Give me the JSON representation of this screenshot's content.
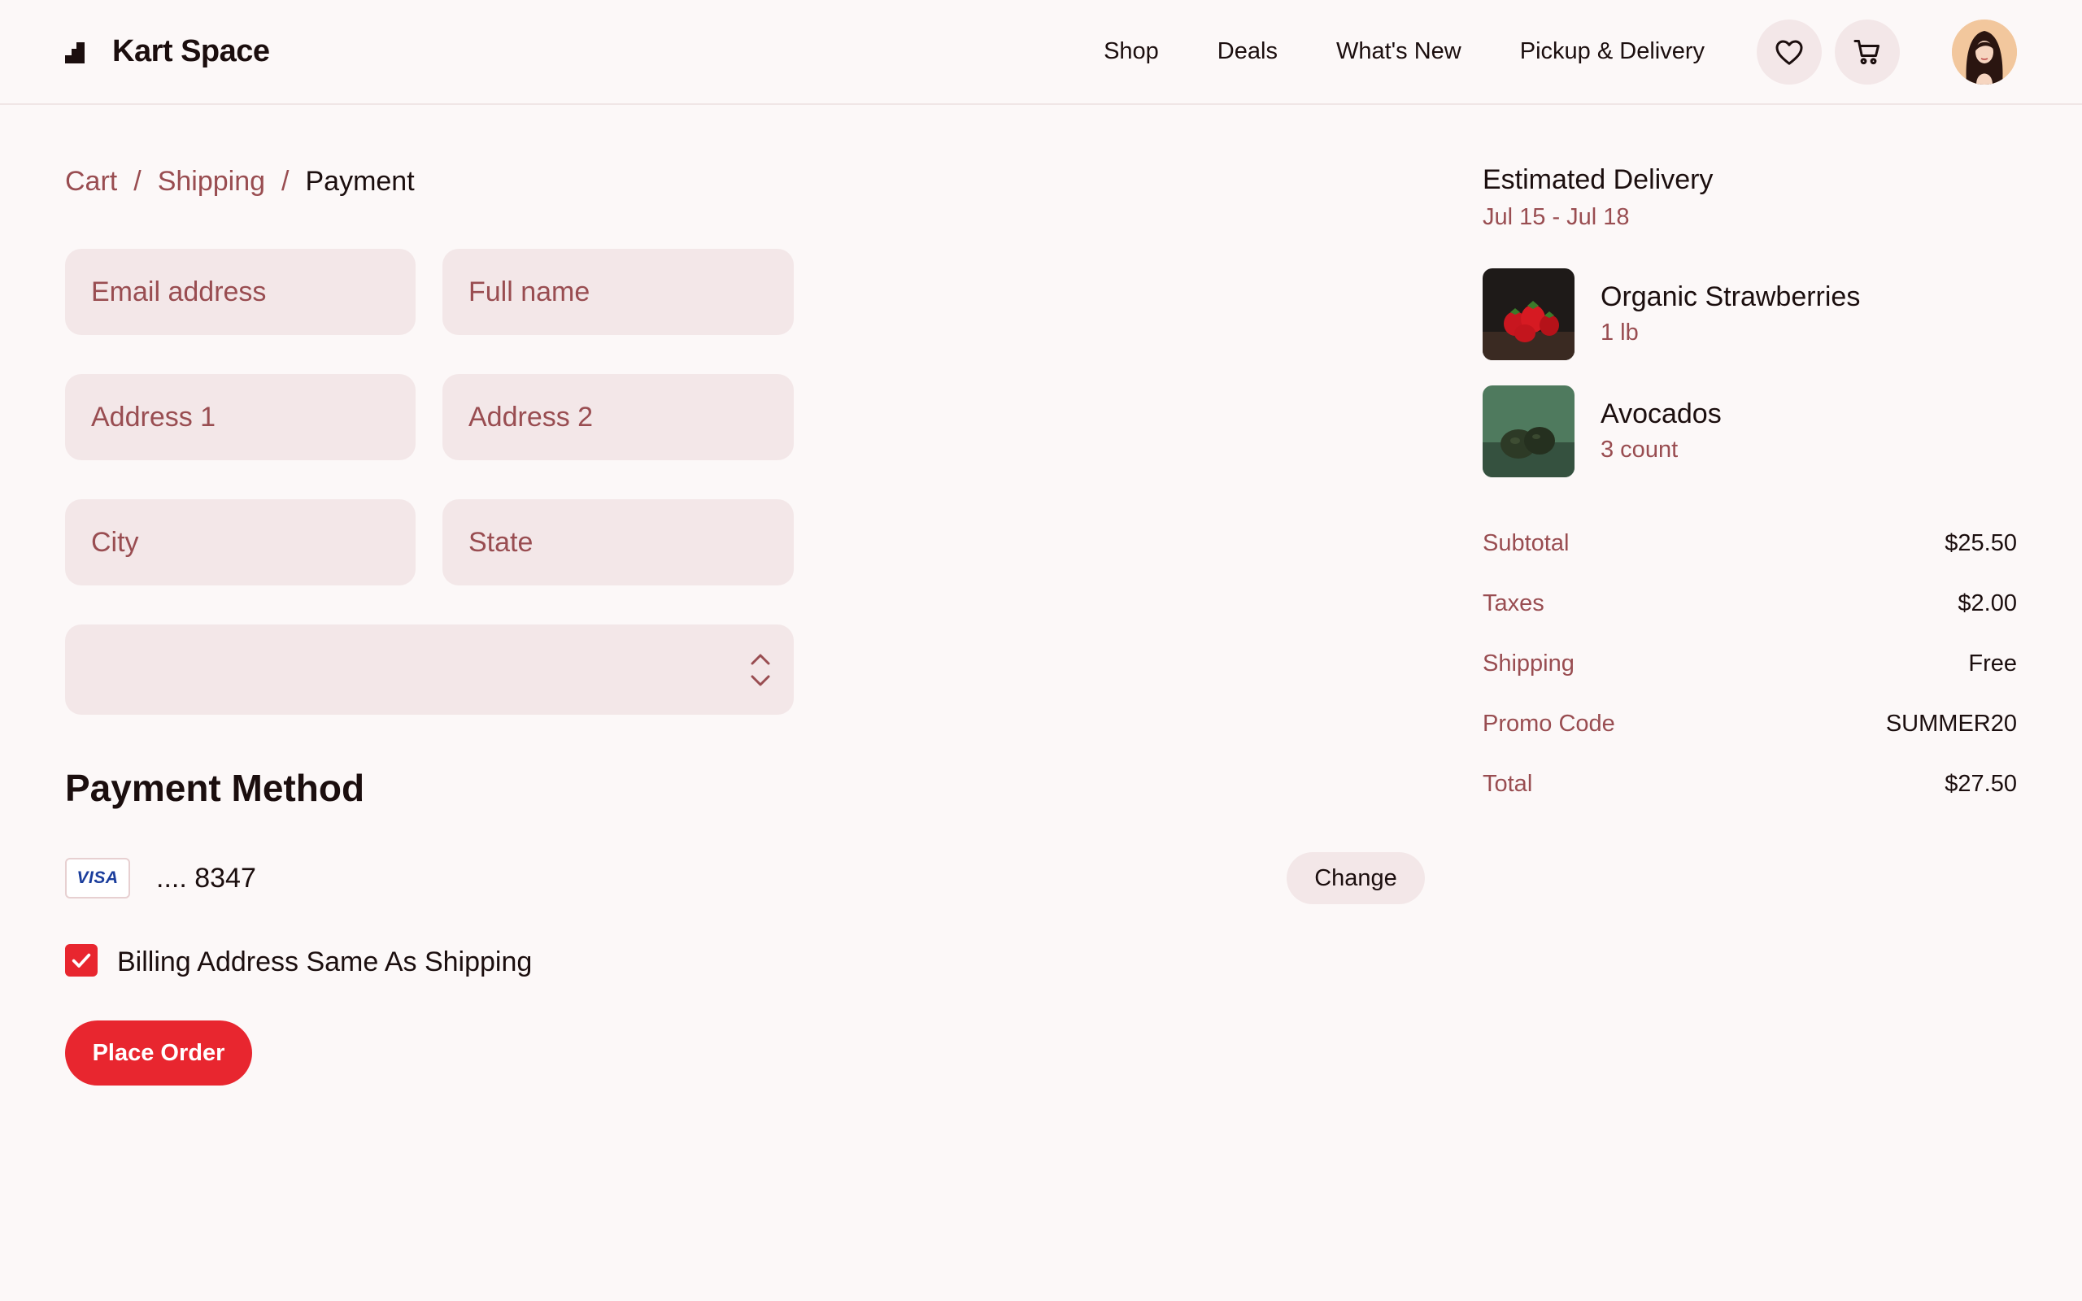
{
  "header": {
    "brand": "Kart Space",
    "nav": [
      "Shop",
      "Deals",
      "What's New",
      "Pickup & Delivery"
    ]
  },
  "breadcrumb": {
    "cart": "Cart",
    "shipping": "Shipping",
    "current": "Payment",
    "separator": "/"
  },
  "form": {
    "email_placeholder": "Email address",
    "fullname_placeholder": "Full name",
    "address1_placeholder": "Address 1",
    "address2_placeholder": "Address 2",
    "city_placeholder": "City",
    "state_placeholder": "State",
    "select_value": ""
  },
  "payment": {
    "title": "Payment Method",
    "card_brand": "VISA",
    "card_number": ".... 8347",
    "change_label": "Change",
    "billing_same_label": "Billing Address Same As Shipping",
    "billing_same_checked": true,
    "place_order_label": "Place Order"
  },
  "summary": {
    "delivery_title": "Estimated Delivery",
    "delivery_range": "Jul 15 - Jul 18",
    "items": [
      {
        "name": "Organic Strawberries",
        "qty": "1 lb"
      },
      {
        "name": "Avocados",
        "qty": "3 count"
      }
    ],
    "rows": [
      {
        "label": "Subtotal",
        "value": "$25.50"
      },
      {
        "label": "Taxes",
        "value": "$2.00"
      },
      {
        "label": "Shipping",
        "value": "Free"
      },
      {
        "label": "Promo Code",
        "value": "SUMMER20"
      },
      {
        "label": "Total",
        "value": "$27.50"
      }
    ]
  },
  "colors": {
    "background": "#fcf8f8",
    "field_bg": "#f3e7e8",
    "muted_text": "#994d51",
    "primary_red": "#e8262f",
    "text": "#1b0e0e"
  },
  "icons": [
    "kart-logo-icon",
    "heart-icon",
    "cart-icon",
    "chevron-up-icon",
    "chevron-down-icon",
    "checkmark-icon"
  ]
}
